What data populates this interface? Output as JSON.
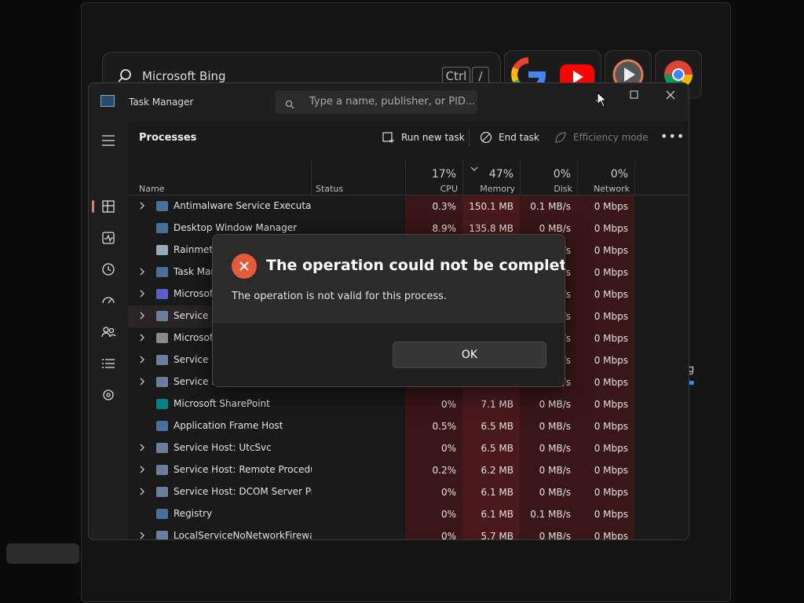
{
  "background": {
    "search_text": "Microsoft Bing",
    "kbd_keys": [
      "Ctrl",
      "/"
    ],
    "tile_icons": [
      "google-icon",
      "youtube-icon",
      "play-icon",
      "chrome-icon"
    ],
    "partial_label": "g"
  },
  "window": {
    "title": "Task Manager",
    "search_placeholder": "Type a name, publisher, or PID..."
  },
  "toolbar": {
    "page_title": "Processes",
    "run_new_task": "Run new task",
    "end_task": "End task",
    "efficiency_mode": "Efficiency mode"
  },
  "columns": {
    "name": "Name",
    "status": "Status",
    "cpu_pct": "17%",
    "cpu": "CPU",
    "memory_pct": "47%",
    "memory": "Memory",
    "disk_pct": "0%",
    "disk": "Disk",
    "network_pct": "0%",
    "network": "Network"
  },
  "rows": [
    {
      "name": "Antimalware Service Executable",
      "cpu": "0.3%",
      "mem": "150.1 MB",
      "disk": "0.1 MB/s",
      "net": "0 Mbps"
    },
    {
      "name": "Desktop Window Manager",
      "cpu": "8.9%",
      "mem": "135.8 MB",
      "disk": "0 MB/s",
      "net": "0 Mbps"
    },
    {
      "name": "Rainmeter",
      "cpu": "",
      "mem": "",
      "disk": "/s",
      "net": "0 Mbps"
    },
    {
      "name": "Task Manager",
      "cpu": "",
      "mem": "",
      "disk": "/s",
      "net": "0 Mbps"
    },
    {
      "name": "Microsoft Teams",
      "cpu": "",
      "mem": "",
      "disk": "/s",
      "net": "0 Mbps"
    },
    {
      "name": "Service Host",
      "cpu": "",
      "mem": "",
      "disk": "/s",
      "net": "0 Mbps"
    },
    {
      "name": "Microsoft",
      "cpu": "",
      "mem": "",
      "disk": "/s",
      "net": "0 Mbps"
    },
    {
      "name": "Service Host",
      "cpu": "",
      "mem": "",
      "disk": "/s",
      "net": "0 Mbps"
    },
    {
      "name": "Service Host",
      "cpu": "",
      "mem": "",
      "disk": "/s",
      "net": "0 Mbps"
    },
    {
      "name": "Microsoft SharePoint",
      "cpu": "0%",
      "mem": "7.1 MB",
      "disk": "0 MB/s",
      "net": "0 Mbps"
    },
    {
      "name": "Application Frame Host",
      "cpu": "0.5%",
      "mem": "6.5 MB",
      "disk": "0 MB/s",
      "net": "0 Mbps"
    },
    {
      "name": "Service Host: UtcSvc",
      "cpu": "0%",
      "mem": "6.5 MB",
      "disk": "0 MB/s",
      "net": "0 Mbps"
    },
    {
      "name": "Service Host: Remote Procedu...",
      "cpu": "0.2%",
      "mem": "6.2 MB",
      "disk": "0 MB/s",
      "net": "0 Mbps"
    },
    {
      "name": "Service Host: DCOM Server Pr...",
      "cpu": "0%",
      "mem": "6.1 MB",
      "disk": "0 MB/s",
      "net": "0 Mbps"
    },
    {
      "name": "Registry",
      "cpu": "0%",
      "mem": "6.1 MB",
      "disk": "0.1 MB/s",
      "net": "0 Mbps"
    },
    {
      "name": "LocalServiceNoNetworkFirewa...",
      "cpu": "0%",
      "mem": "5.7 MB",
      "disk": "0 MB/s",
      "net": "0 Mbps"
    }
  ],
  "dialog": {
    "title": "The operation could not be completed.",
    "message": "The operation is not valid for this process.",
    "ok": "OK"
  },
  "colors": {
    "accent_active": "#e07a7a",
    "error_icon": "#e45a3a",
    "heat_cell": "#3a1616",
    "heat_cell_mem": "#4a1a1a"
  }
}
